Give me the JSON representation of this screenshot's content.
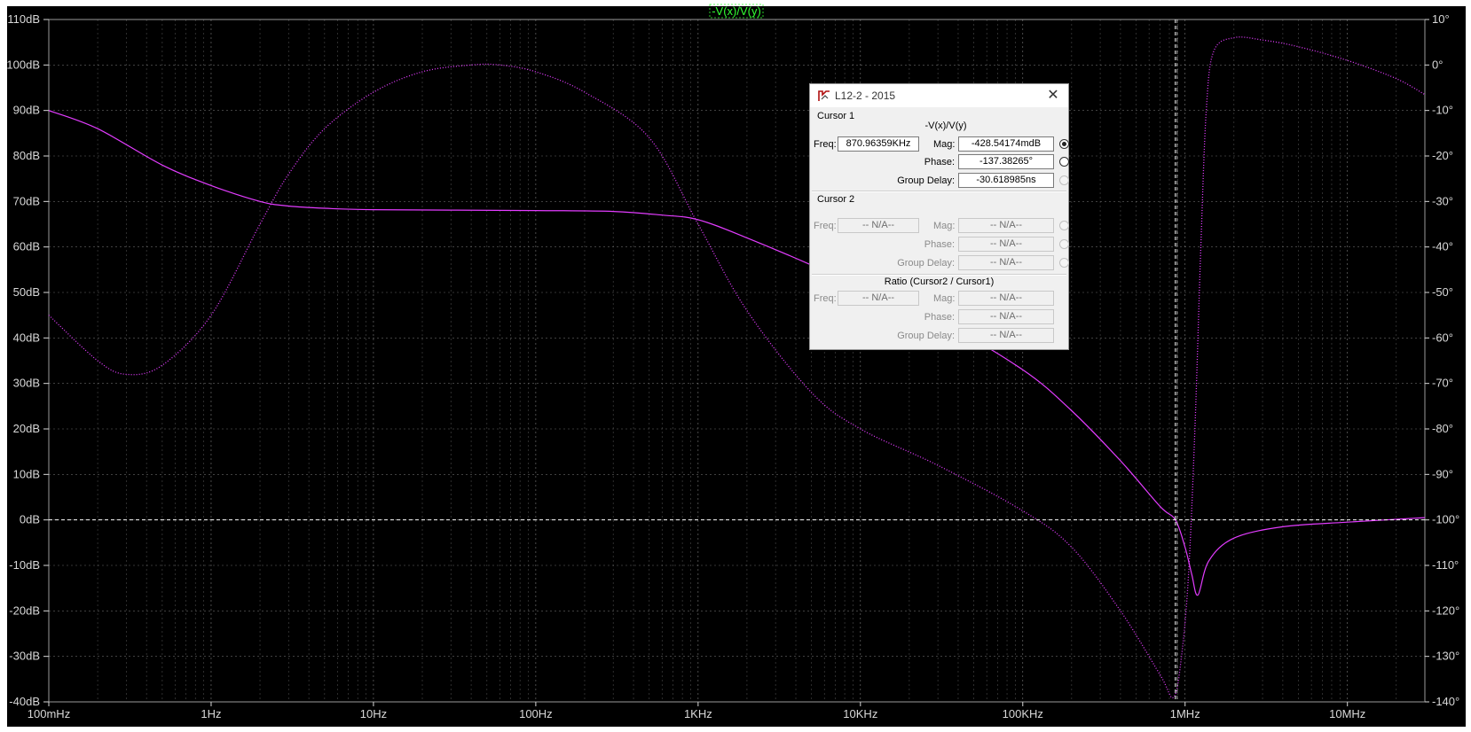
{
  "chart_data": {
    "type": "line",
    "title": "-V(x)/V(y)",
    "x_scale": "log",
    "xlim": [
      0.1,
      30000000
    ],
    "ylim_left": [
      -40,
      110
    ],
    "ylim_right": [
      -140,
      10
    ],
    "x_ticks": [
      {
        "v": 0.1,
        "label": "100mHz"
      },
      {
        "v": 1,
        "label": "1Hz"
      },
      {
        "v": 10,
        "label": "10Hz"
      },
      {
        "v": 100,
        "label": "100Hz"
      },
      {
        "v": 1000,
        "label": "1KHz"
      },
      {
        "v": 10000,
        "label": "10KHz"
      },
      {
        "v": 100000,
        "label": "100KHz"
      },
      {
        "v": 1000000,
        "label": "1MHz"
      },
      {
        "v": 10000000,
        "label": "10MHz"
      }
    ],
    "y_left_ticks": [
      "110dB",
      "100dB",
      "90dB",
      "80dB",
      "70dB",
      "60dB",
      "50dB",
      "40dB",
      "30dB",
      "20dB",
      "10dB",
      "0dB",
      "-10dB",
      "-20dB",
      "-30dB",
      "-40dB"
    ],
    "y_right_ticks": [
      "10°",
      "0°",
      "-10°",
      "-20°",
      "-30°",
      "-40°",
      "-50°",
      "-60°",
      "-70°",
      "-80°",
      "-90°",
      "-100°",
      "-110°",
      "-120°",
      "-130°",
      "-140°"
    ],
    "grid": true,
    "color": "#e33cff",
    "series": [
      {
        "quantity": "magnitude",
        "unit": "dB",
        "axis": "left",
        "style": "solid",
        "points": [
          [
            0.1,
            90
          ],
          [
            0.2,
            86
          ],
          [
            0.5,
            78
          ],
          [
            1,
            73.5
          ],
          [
            2,
            70
          ],
          [
            3,
            69
          ],
          [
            5,
            68.5
          ],
          [
            10,
            68.2
          ],
          [
            100,
            68
          ],
          [
            300,
            67.8
          ],
          [
            600,
            67
          ],
          [
            1000,
            66
          ],
          [
            2000,
            62
          ],
          [
            5000,
            56
          ],
          [
            10000,
            51
          ],
          [
            30000,
            44
          ],
          [
            100000,
            33
          ],
          [
            200000,
            24
          ],
          [
            400000,
            13
          ],
          [
            700000,
            3
          ],
          [
            870963,
            0
          ],
          [
            1000000,
            -6
          ],
          [
            1100000,
            -12
          ],
          [
            1200000,
            -16.5
          ],
          [
            1400000,
            -9
          ],
          [
            2000000,
            -4
          ],
          [
            4000000,
            -1.5
          ],
          [
            10000000,
            -0.5
          ],
          [
            30000000,
            0.5
          ]
        ]
      },
      {
        "quantity": "phase",
        "unit": "deg",
        "axis": "right",
        "style": "dotted",
        "points": [
          [
            0.1,
            -55
          ],
          [
            0.2,
            -65
          ],
          [
            0.3,
            -68
          ],
          [
            0.5,
            -66
          ],
          [
            1,
            -55
          ],
          [
            2,
            -35
          ],
          [
            3,
            -24
          ],
          [
            5,
            -14
          ],
          [
            10,
            -6
          ],
          [
            20,
            -1.5
          ],
          [
            40,
            0
          ],
          [
            60,
            0
          ],
          [
            100,
            -1.5
          ],
          [
            200,
            -6
          ],
          [
            500,
            -16
          ],
          [
            1000,
            -35
          ],
          [
            2000,
            -54
          ],
          [
            5000,
            -72
          ],
          [
            10000,
            -80
          ],
          [
            30000,
            -88
          ],
          [
            100000,
            -98
          ],
          [
            200000,
            -106
          ],
          [
            400000,
            -120
          ],
          [
            700000,
            -134
          ],
          [
            850000,
            -139
          ],
          [
            950000,
            -130
          ],
          [
            1050000,
            -112
          ],
          [
            1150000,
            -80
          ],
          [
            1250000,
            -40
          ],
          [
            1350000,
            -10
          ],
          [
            1500000,
            3
          ],
          [
            2000000,
            6
          ],
          [
            3000000,
            5.5
          ],
          [
            5000000,
            4
          ],
          [
            10000000,
            1
          ],
          [
            20000000,
            -3
          ],
          [
            30000000,
            -6.5
          ]
        ]
      }
    ],
    "cursor_freq": 870963.59
  },
  "dialog": {
    "title": "L12-2 - 2015",
    "close_glyph": "✕",
    "cursor1": {
      "heading": "Cursor 1",
      "expression": "-V(x)/V(y)",
      "freq_label": "Freq:",
      "freq_value": "870.96359KHz",
      "mag_label": "Mag:",
      "mag_value": "-428.54174mdB",
      "phase_label": "Phase:",
      "phase_value": "-137.38265°",
      "gd_label": "Group Delay:",
      "gd_value": "-30.618985ns"
    },
    "cursor2": {
      "heading": "Cursor 2",
      "freq_label": "Freq:",
      "freq_value": "-- N/A--",
      "mag_label": "Mag:",
      "mag_value": "-- N/A--",
      "phase_label": "Phase:",
      "phase_value": "-- N/A--",
      "gd_label": "Group Delay:",
      "gd_value": "-- N/A--"
    },
    "ratio": {
      "heading": "Ratio (Cursor2 / Cursor1)",
      "freq_label": "Freq:",
      "freq_value": "-- N/A--",
      "mag_label": "Mag:",
      "mag_value": "-- N/A--",
      "phase_label": "Phase:",
      "phase_value": "-- N/A--",
      "gd_label": "Group Delay:",
      "gd_value": "-- N/A--"
    }
  }
}
